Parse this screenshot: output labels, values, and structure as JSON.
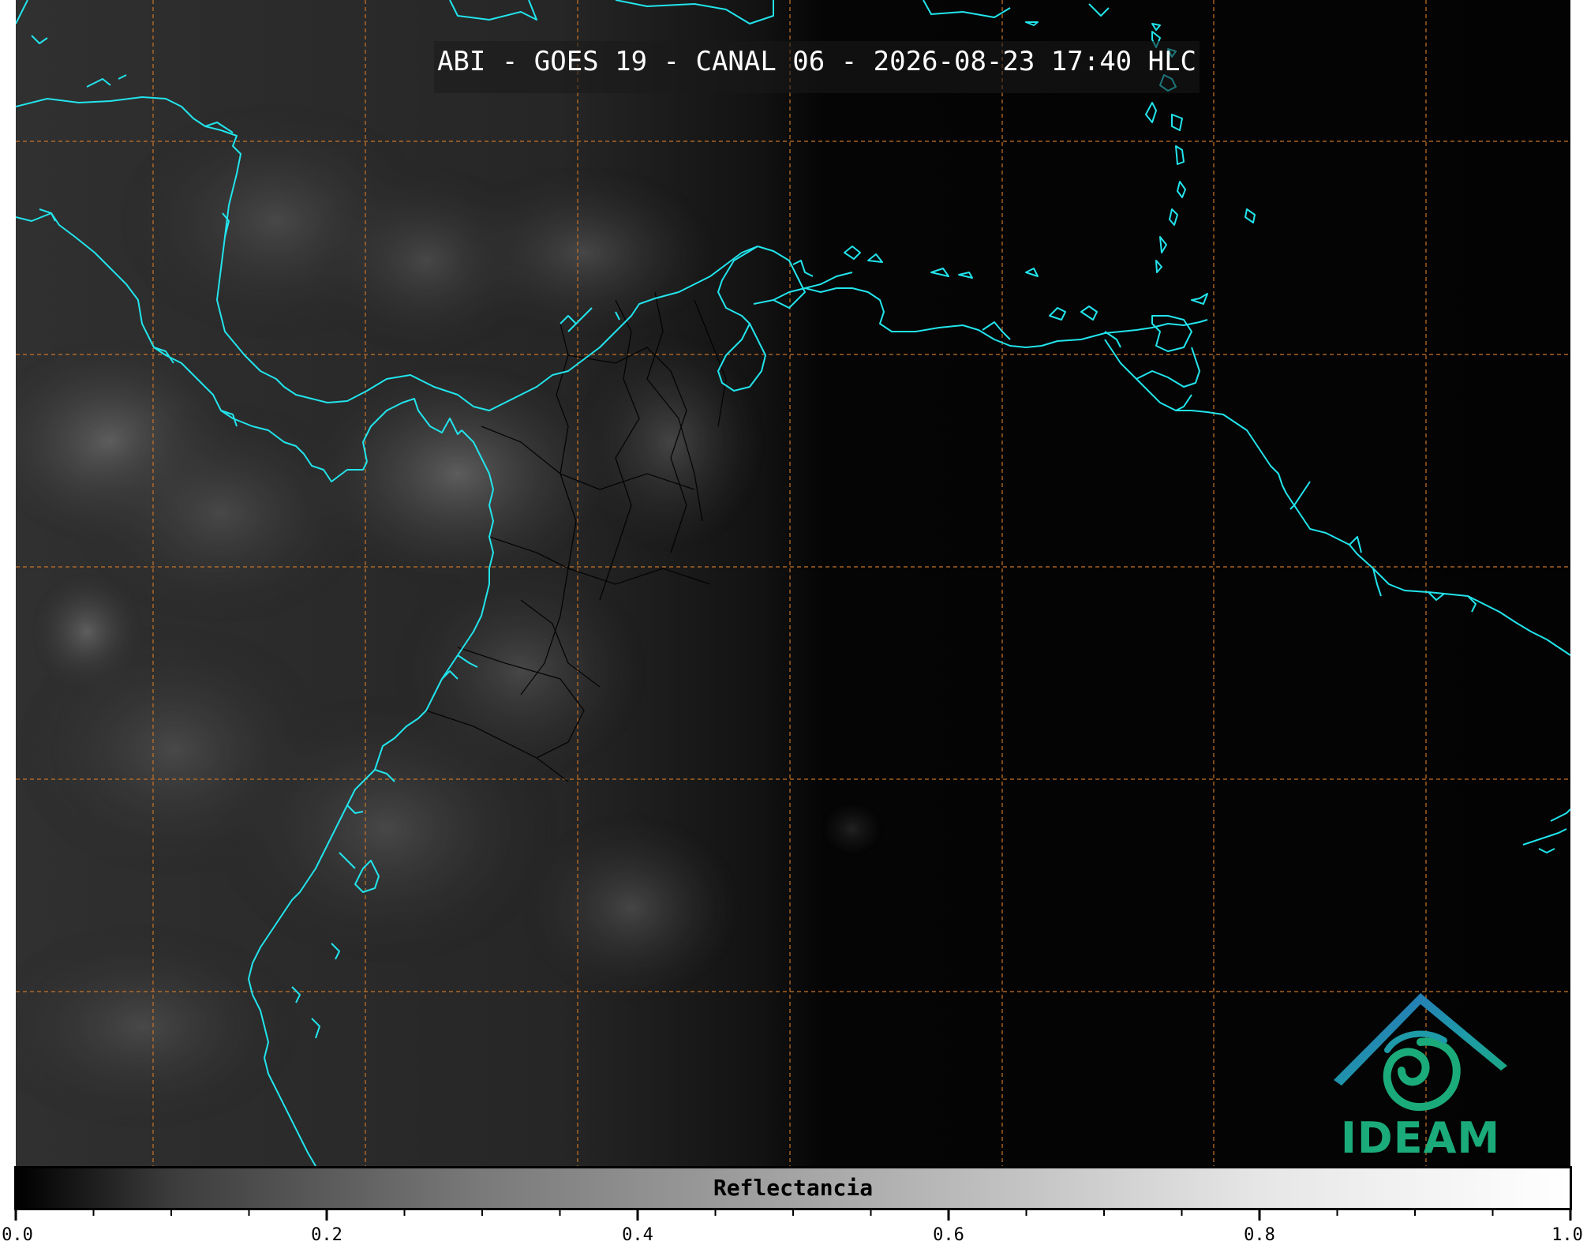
{
  "map": {
    "title": "ABI - GOES 19 - CANAL 06 - 2026-08-23 17:40 HLC",
    "channel": "CANAL 06",
    "satellite": "GOES 19",
    "coastline_color": "#22e4ec",
    "graticule_color": "#c8742a",
    "border_color": "#000000"
  },
  "colorbar": {
    "label": "Reflectancia",
    "ticks": [
      "0.0",
      "0.2",
      "0.4",
      "0.6",
      "0.8",
      "1.0"
    ],
    "range": [
      0.0,
      1.0
    ]
  },
  "logo": {
    "text": "IDEAM",
    "icon": "ideam-logo-icon"
  }
}
